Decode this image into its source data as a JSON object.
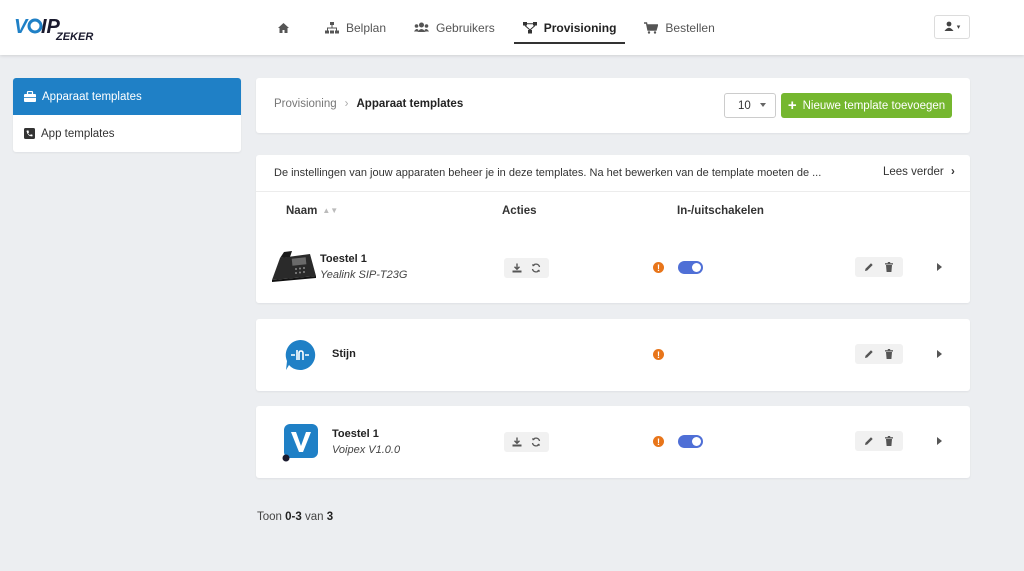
{
  "brand": {
    "logo_main": "VOIP",
    "logo_sub": "ZEKER",
    "colors": {
      "primary": "#1f80c6",
      "success": "#75b72f",
      "warning": "#e8751a",
      "toggle": "#4f6fd6",
      "logo_blue": "#1f80c6",
      "logo_dark": "#1a1a2e"
    }
  },
  "nav": {
    "items": [
      {
        "label": "",
        "icon": "home-icon",
        "active": false
      },
      {
        "label": "Belplan",
        "icon": "sitemap-icon",
        "active": false
      },
      {
        "label": "Gebruikers",
        "icon": "users-icon",
        "active": false
      },
      {
        "label": "Provisioning",
        "icon": "network-icon",
        "active": true
      },
      {
        "label": "Bestellen",
        "icon": "cart-icon",
        "active": false
      }
    ],
    "user_menu_icon": "user-icon"
  },
  "sidebar": {
    "items": [
      {
        "label": "Apparaat templates",
        "icon": "briefcase-icon",
        "active": true
      },
      {
        "label": "App templates",
        "icon": "phone-square-icon",
        "active": false
      }
    ]
  },
  "header": {
    "breadcrumb": [
      "Provisioning",
      "Apparaat templates"
    ],
    "per_page": "10",
    "add_button": "Nieuwe template toevoegen"
  },
  "info": {
    "text": "De instellingen van jouw apparaten beheer je in deze templates. Na het bewerken van de template moeten de ...",
    "read_more": "Lees verder"
  },
  "table": {
    "columns": {
      "name": "Naam",
      "actions": "Acties",
      "toggle": "In-/uitschakelen"
    },
    "rows": [
      {
        "title": "Toestel 1",
        "subtitle": "Yealink SIP-T23G",
        "image": "desk-phone",
        "has_actions": true,
        "has_toggle": true,
        "enabled": true,
        "warning": "!"
      },
      {
        "title": "Stijn",
        "subtitle": "",
        "image": "app-chat-logo",
        "has_actions": false,
        "has_toggle": false,
        "enabled": false,
        "warning": "!"
      },
      {
        "title": "Toestel 1",
        "subtitle": "Voipex V1.0.0",
        "image": "voipex-logo",
        "has_actions": true,
        "has_toggle": true,
        "enabled": true,
        "warning": "!"
      }
    ]
  },
  "footer": {
    "prefix": "Toon ",
    "range": "0-3",
    "middle": " van ",
    "total": "3"
  }
}
